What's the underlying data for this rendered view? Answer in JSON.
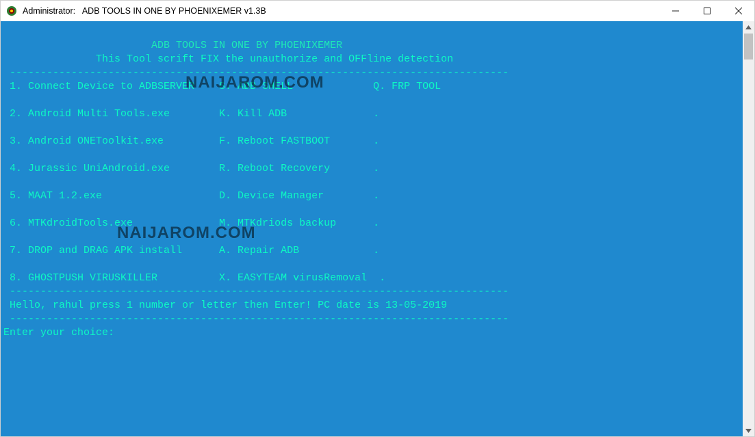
{
  "titlebar": {
    "text": "Administrator:   ADB TOOLS IN ONE BY PHOENIXEMER v1.3B"
  },
  "controls": {
    "minimize": "minimize",
    "maximize": "maximize",
    "close": "close"
  },
  "console": {
    "header1": "                        ADB TOOLS IN ONE BY PHOENIXEMER",
    "header2": "               This Tool scrift FIX the unauthorize and OFFline detection",
    "dash": " ---------------------------------------------------------------------------------",
    "rows": [
      " 1. Connect Device to ADBSERVER    S. ADB SHELL             Q. FRP TOOL",
      "",
      " 2. Android Multi Tools.exe        K. Kill ADB              .",
      "",
      " 3. Android ONEToolkit.exe         F. Reboot FASTBOOT       .",
      "",
      " 4. Jurassic UniAndroid.exe        R. Reboot Recovery       .",
      "",
      " 5. MAAT 1.2.exe                   D. Device Manager        .",
      "",
      " 6. MTKdroidTools.exe              M. MTKdriods backup      .",
      "",
      " 7. DROP and DRAG APK install      A. Repair ADB            .",
      "",
      " 8. GHOSTPUSH VIRUSKILLER          X. EASYTEAM virusRemoval  ."
    ],
    "footer1": " Hello, rahul press 1 number or letter then Enter! PC date is 13-05-2019",
    "prompt": "Enter your choice:"
  },
  "watermark": "NAIJAROM.COM"
}
